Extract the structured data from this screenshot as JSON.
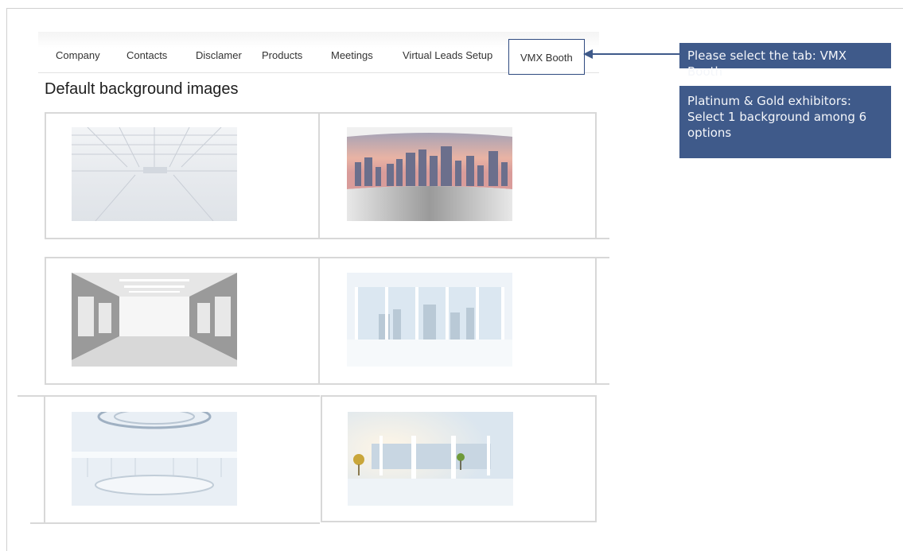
{
  "tabs": [
    {
      "label": "Company"
    },
    {
      "label": "Contacts"
    },
    {
      "label": "Disclamer"
    },
    {
      "label": "Products"
    },
    {
      "label": "Meetings"
    },
    {
      "label": "Virtual Leads Setup"
    },
    {
      "label": "VMX Booth",
      "active": true
    }
  ],
  "section_title": "Default background images",
  "backgrounds": [
    {
      "icon": "warehouse-hall-image"
    },
    {
      "icon": "city-skyline-image"
    },
    {
      "icon": "bright-corridor-image"
    },
    {
      "icon": "window-wall-city-image"
    },
    {
      "icon": "round-futuristic-hall-image"
    },
    {
      "icon": "sunlit-lobby-image"
    }
  ],
  "annotations": {
    "tab_hint": "Please select the tab: VMX Booth",
    "selection_hint": "Platinum & Gold exhibitors: Select 1 background among 6 options"
  },
  "colors": {
    "annotation_bg": "#3f5a8a",
    "active_tab_border": "#2f4a80"
  }
}
